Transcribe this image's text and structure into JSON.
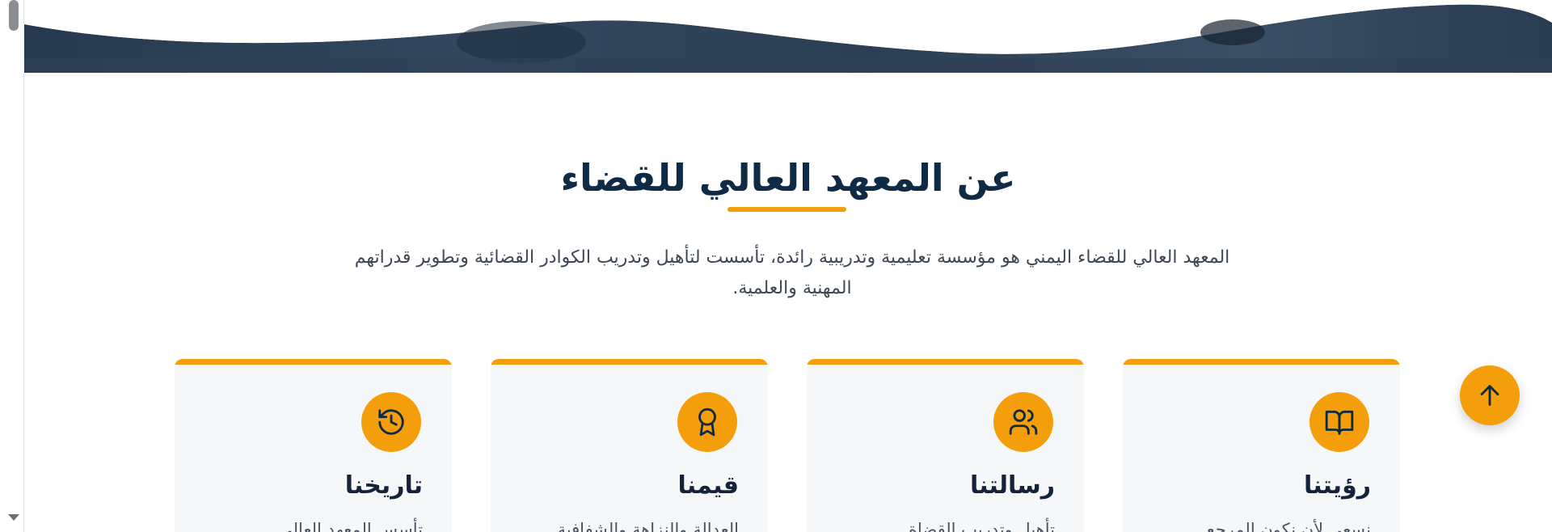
{
  "about": {
    "title": "عن المعهد العالي للقضاء",
    "intro": "المعهد العالي للقضاء اليمني هو مؤسسة تعليمية وتدريبية رائدة، تأسست لتأهيل وتدريب الكوادر القضائية وتطوير قدراتهم المهنية والعلمية."
  },
  "cards": [
    {
      "title": "رؤيتنا",
      "text": "نسعى لأن نكون المرجع",
      "icon": "book-open-icon"
    },
    {
      "title": "رسالتنا",
      "text": "تأهيل وتدريب القضاة",
      "icon": "users-icon"
    },
    {
      "title": "قيمنا",
      "text": "العدالة والنزاهة والشفافية",
      "icon": "award-icon"
    },
    {
      "title": "تاريخنا",
      "text": "تأسس المعهد العالي",
      "icon": "history-icon"
    }
  ],
  "colors": {
    "accent": "#f59e0b",
    "title": "#0f2a44",
    "hero": "#1f3246"
  },
  "controls": {
    "scroll_top_icon": "arrow-up-icon"
  }
}
